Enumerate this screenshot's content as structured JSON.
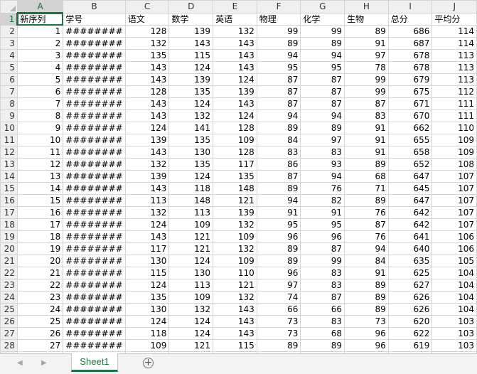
{
  "columns": [
    "A",
    "B",
    "C",
    "D",
    "E",
    "F",
    "G",
    "H",
    "I",
    "J"
  ],
  "headers": [
    "新序列",
    "学号",
    "语文",
    "数学",
    "英语",
    "物理",
    "化学",
    "生物",
    "总分",
    "平均分"
  ],
  "rows": [
    [
      "1",
      "########",
      "128",
      "139",
      "132",
      "99",
      "99",
      "89",
      "686",
      "114"
    ],
    [
      "2",
      "########",
      "132",
      "143",
      "143",
      "89",
      "89",
      "91",
      "687",
      "114"
    ],
    [
      "3",
      "########",
      "135",
      "115",
      "143",
      "94",
      "94",
      "97",
      "678",
      "113"
    ],
    [
      "4",
      "########",
      "143",
      "124",
      "143",
      "95",
      "95",
      "78",
      "678",
      "113"
    ],
    [
      "5",
      "########",
      "143",
      "139",
      "124",
      "87",
      "87",
      "99",
      "679",
      "113"
    ],
    [
      "6",
      "########",
      "128",
      "135",
      "139",
      "87",
      "87",
      "99",
      "675",
      "112"
    ],
    [
      "7",
      "########",
      "143",
      "124",
      "143",
      "87",
      "87",
      "87",
      "671",
      "111"
    ],
    [
      "8",
      "########",
      "143",
      "132",
      "124",
      "94",
      "94",
      "83",
      "670",
      "111"
    ],
    [
      "9",
      "########",
      "124",
      "141",
      "128",
      "89",
      "89",
      "91",
      "662",
      "110"
    ],
    [
      "10",
      "########",
      "139",
      "135",
      "109",
      "84",
      "97",
      "91",
      "655",
      "109"
    ],
    [
      "11",
      "########",
      "143",
      "130",
      "128",
      "83",
      "83",
      "91",
      "658",
      "109"
    ],
    [
      "12",
      "########",
      "132",
      "135",
      "117",
      "86",
      "93",
      "89",
      "652",
      "108"
    ],
    [
      "13",
      "########",
      "139",
      "124",
      "135",
      "87",
      "94",
      "68",
      "647",
      "107"
    ],
    [
      "14",
      "########",
      "143",
      "118",
      "148",
      "89",
      "76",
      "71",
      "645",
      "107"
    ],
    [
      "15",
      "########",
      "113",
      "148",
      "121",
      "94",
      "82",
      "89",
      "647",
      "107"
    ],
    [
      "16",
      "########",
      "132",
      "113",
      "139",
      "91",
      "91",
      "76",
      "642",
      "107"
    ],
    [
      "17",
      "########",
      "124",
      "109",
      "132",
      "95",
      "95",
      "87",
      "642",
      "107"
    ],
    [
      "18",
      "########",
      "143",
      "121",
      "109",
      "96",
      "96",
      "76",
      "641",
      "106"
    ],
    [
      "19",
      "########",
      "117",
      "121",
      "132",
      "89",
      "87",
      "94",
      "640",
      "106"
    ],
    [
      "20",
      "########",
      "130",
      "124",
      "109",
      "89",
      "99",
      "84",
      "635",
      "105"
    ],
    [
      "21",
      "########",
      "115",
      "130",
      "110",
      "96",
      "83",
      "91",
      "625",
      "104"
    ],
    [
      "22",
      "########",
      "124",
      "113",
      "121",
      "97",
      "83",
      "89",
      "627",
      "104"
    ],
    [
      "23",
      "########",
      "135",
      "109",
      "132",
      "74",
      "87",
      "89",
      "626",
      "104"
    ],
    [
      "24",
      "########",
      "130",
      "132",
      "143",
      "66",
      "66",
      "89",
      "626",
      "104"
    ],
    [
      "25",
      "########",
      "124",
      "124",
      "143",
      "73",
      "83",
      "73",
      "620",
      "103"
    ],
    [
      "26",
      "########",
      "118",
      "124",
      "143",
      "73",
      "68",
      "96",
      "622",
      "103"
    ],
    [
      "27",
      "########",
      "109",
      "121",
      "115",
      "89",
      "89",
      "96",
      "619",
      "103"
    ]
  ],
  "partial_row": [
    "",
    "",
    "",
    "",
    "",
    "",
    "",
    "",
    "",
    ""
  ],
  "sheet_tab": "Sheet1",
  "add_sheet_symbol": "+",
  "nav_prev": "◀",
  "nav_next": "▶",
  "colors": {
    "accent": "#1e7145",
    "header_bg": "#efefef",
    "grid": "#d4d4d4"
  }
}
